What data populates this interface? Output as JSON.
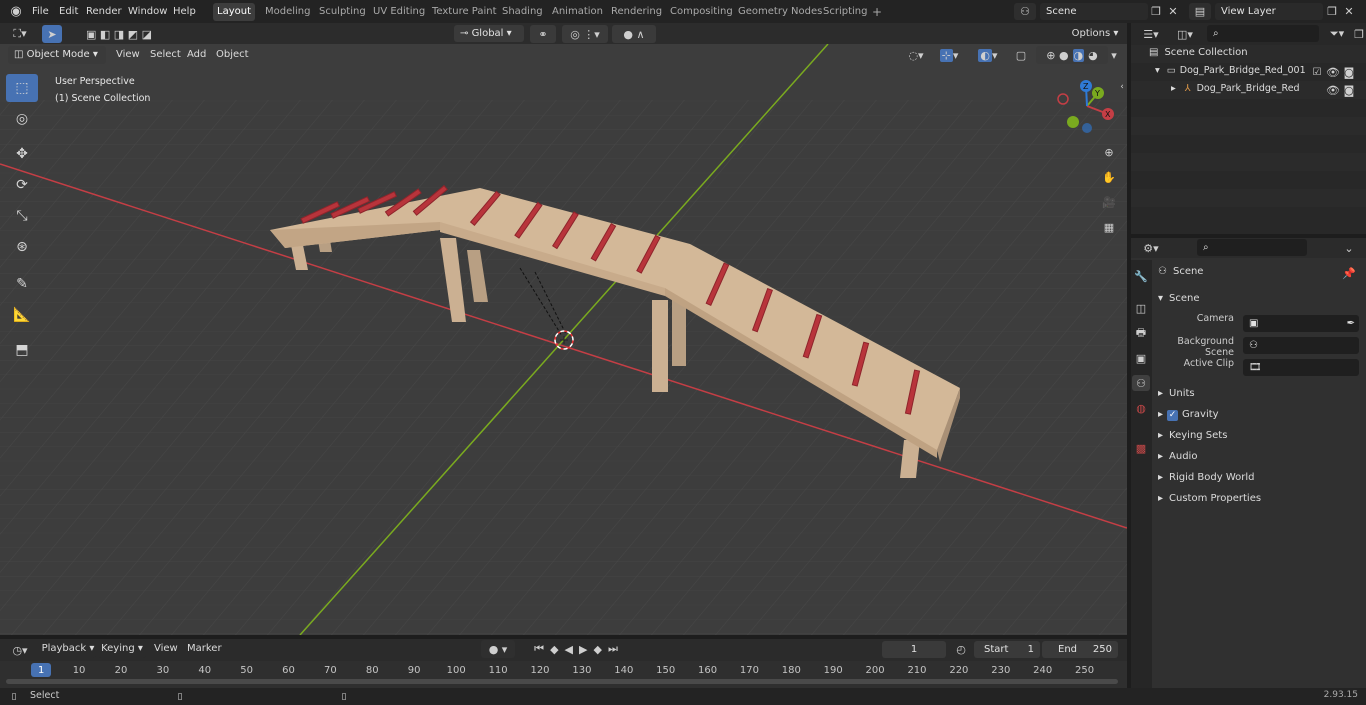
{
  "menu": {
    "items": [
      "File",
      "Edit",
      "Render",
      "Window",
      "Help"
    ]
  },
  "workspaces": {
    "tabs": [
      "Layout",
      "Modeling",
      "Sculpting",
      "UV Editing",
      "Texture Paint",
      "Shading",
      "Animation",
      "Rendering",
      "Compositing",
      "Geometry Nodes",
      "Scripting"
    ],
    "add": "+"
  },
  "scene": {
    "name": "Scene"
  },
  "view_layer": {
    "name": "View Layer"
  },
  "viewport_header": {
    "mode": "Object Mode",
    "menus": [
      "View",
      "Select",
      "Add",
      "Object"
    ],
    "orientation": "Global",
    "options": "Options"
  },
  "viewport": {
    "perspective": "User Perspective",
    "collection": "(1) Scene Collection",
    "gizmo": {
      "x": "X",
      "y": "Y",
      "z": "Z"
    }
  },
  "outliner": {
    "root": "Scene Collection",
    "collection": "Dog_Park_Bridge_Red_001",
    "object": "Dog_Park_Bridge_Red"
  },
  "properties": {
    "header": "Scene",
    "panel": "Scene",
    "camera_label": "Camera",
    "bg_scene_label": "Background Scene",
    "active_clip_label": "Active Clip",
    "sections": [
      "Units",
      "Gravity",
      "Keying Sets",
      "Audio",
      "Rigid Body World",
      "Custom Properties"
    ],
    "gravity_checked": true
  },
  "timeline": {
    "menus": [
      "Playback",
      "Keying",
      "View",
      "Marker"
    ],
    "current_frame": "1",
    "start_label": "Start",
    "start": "1",
    "end_label": "End",
    "end": "250",
    "ruler": [
      "1",
      "10",
      "20",
      "30",
      "40",
      "50",
      "60",
      "70",
      "80",
      "90",
      "100",
      "110",
      "120",
      "130",
      "140",
      "150",
      "160",
      "170",
      "180",
      "190",
      "200",
      "210",
      "220",
      "230",
      "240",
      "250"
    ]
  },
  "status": {
    "action": "Select",
    "version": "2.93.15"
  },
  "colors": {
    "accent": "#4772b3",
    "x_axis": "#c43e45",
    "y_axis": "#7aaa1f",
    "bridge": "#cdb394",
    "rungs": "#b8343b"
  }
}
